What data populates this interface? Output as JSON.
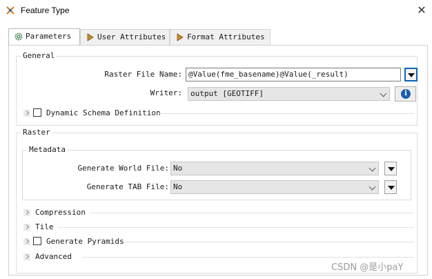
{
  "window": {
    "title": "Feature Type"
  },
  "tabs": [
    {
      "label": "Parameters",
      "icon": "gear-icon"
    },
    {
      "label": "User Attributes",
      "icon": "arrow-right-icon"
    },
    {
      "label": "Format Attributes",
      "icon": "arrow-right-icon"
    }
  ],
  "general": {
    "title": "General",
    "raster_file_name": {
      "label": "Raster File Name:",
      "value": "@Value(fme_basename)@Value(_result)"
    },
    "writer": {
      "label": "Writer:",
      "value": "output [GEOTIFF]"
    },
    "dynamic_schema": {
      "label": "Dynamic Schema Definition",
      "checked": false
    }
  },
  "raster": {
    "title": "Raster",
    "metadata": {
      "title": "Metadata",
      "world_file": {
        "label": "Generate World File:",
        "value": "No"
      },
      "tab_file": {
        "label": "Generate TAB File:",
        "value": "No"
      }
    },
    "compression": {
      "label": "Compression"
    },
    "tile": {
      "label": "Tile"
    },
    "pyramids": {
      "label": "Generate Pyramids",
      "checked": false
    },
    "advanced": {
      "label": "Advanced"
    }
  },
  "watermark": "CSDN @是小paY",
  "colors": {
    "focus_border": "#0a64b8",
    "info_icon": "#1f5fad",
    "combo_bg": "#e6e6e6"
  }
}
